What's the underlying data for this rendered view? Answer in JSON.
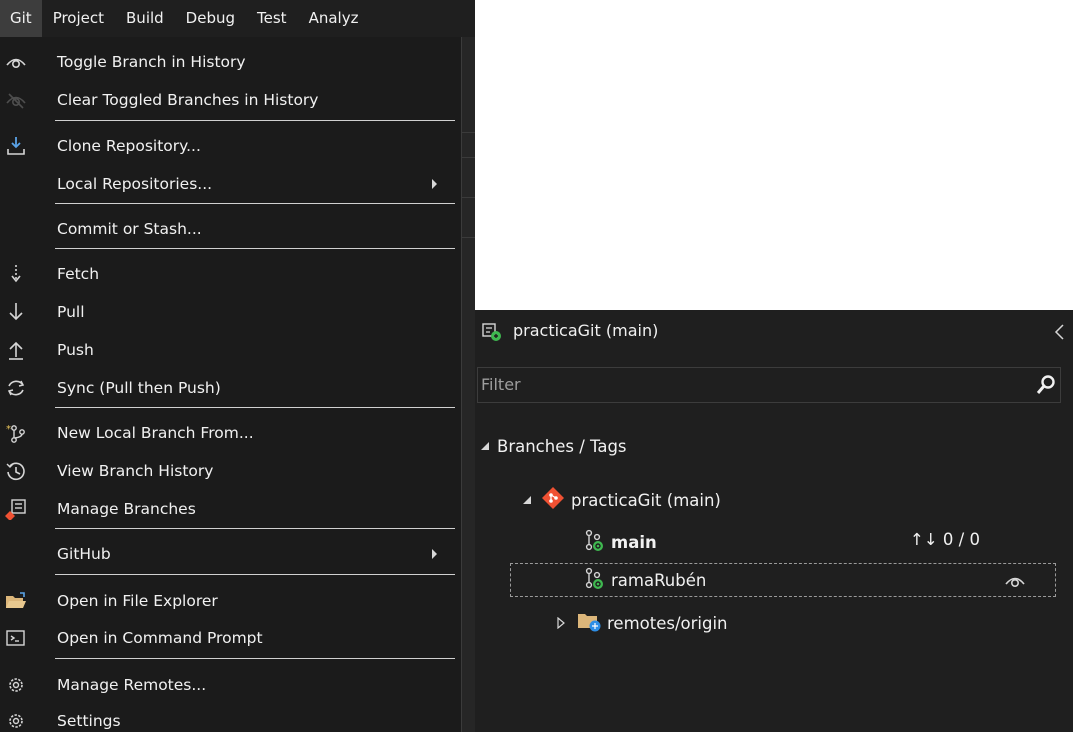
{
  "menubar": {
    "items": [
      "Git",
      "Project",
      "Build",
      "Debug",
      "Test",
      "Analyz"
    ]
  },
  "git_menu": {
    "items": [
      {
        "label": "Toggle Branch in History",
        "icon": "eye-icon"
      },
      {
        "label": "Clear Toggled Branches in History",
        "icon": "eye-off-icon"
      },
      {
        "label": "Clone Repository...",
        "icon": "clone-download-icon"
      },
      {
        "label": "Local Repositories...",
        "icon": "",
        "submenu": true
      },
      {
        "label": "Commit or Stash...",
        "icon": ""
      },
      {
        "label": "Fetch",
        "icon": "fetch-dotted-arrow-icon"
      },
      {
        "label": "Pull",
        "icon": "arrow-down-icon"
      },
      {
        "label": "Push",
        "icon": "arrow-up-icon"
      },
      {
        "label": "Sync (Pull then Push)",
        "icon": "sync-icon"
      },
      {
        "label": "New Local Branch From...",
        "icon": "new-branch-icon"
      },
      {
        "label": "View Branch History",
        "icon": "history-icon"
      },
      {
        "label": "Manage Branches",
        "icon": "manage-branches-icon"
      },
      {
        "label": "GitHub",
        "icon": "",
        "submenu": true
      },
      {
        "label": "Open in File Explorer",
        "icon": "folder-open-icon"
      },
      {
        "label": "Open in Command Prompt",
        "icon": "terminal-icon"
      },
      {
        "label": "Manage Remotes...",
        "icon": "gear-icon"
      },
      {
        "label": "Settings",
        "icon": "gear-icon"
      }
    ]
  },
  "repo_pane": {
    "title": "practicaGit (main)",
    "filter_placeholder": "Filter",
    "tree": {
      "root_label": "Branches / Tags",
      "repo_label": "practicaGit (main)",
      "branches": [
        {
          "name": "main",
          "bold": true,
          "sync_status": "0 / 0"
        },
        {
          "name": "ramaRubén",
          "bold": false,
          "toggled": true
        }
      ],
      "remotes_label": "remotes/origin"
    }
  },
  "colors": {
    "menu_bg": "#1b1b1b",
    "menubar_active": "#3d3d3d",
    "git_orange": "#f05133",
    "branch_green": "#3fb950",
    "remote_blue": "#2d8ee6",
    "folder_yellow": "#dcb67a"
  }
}
